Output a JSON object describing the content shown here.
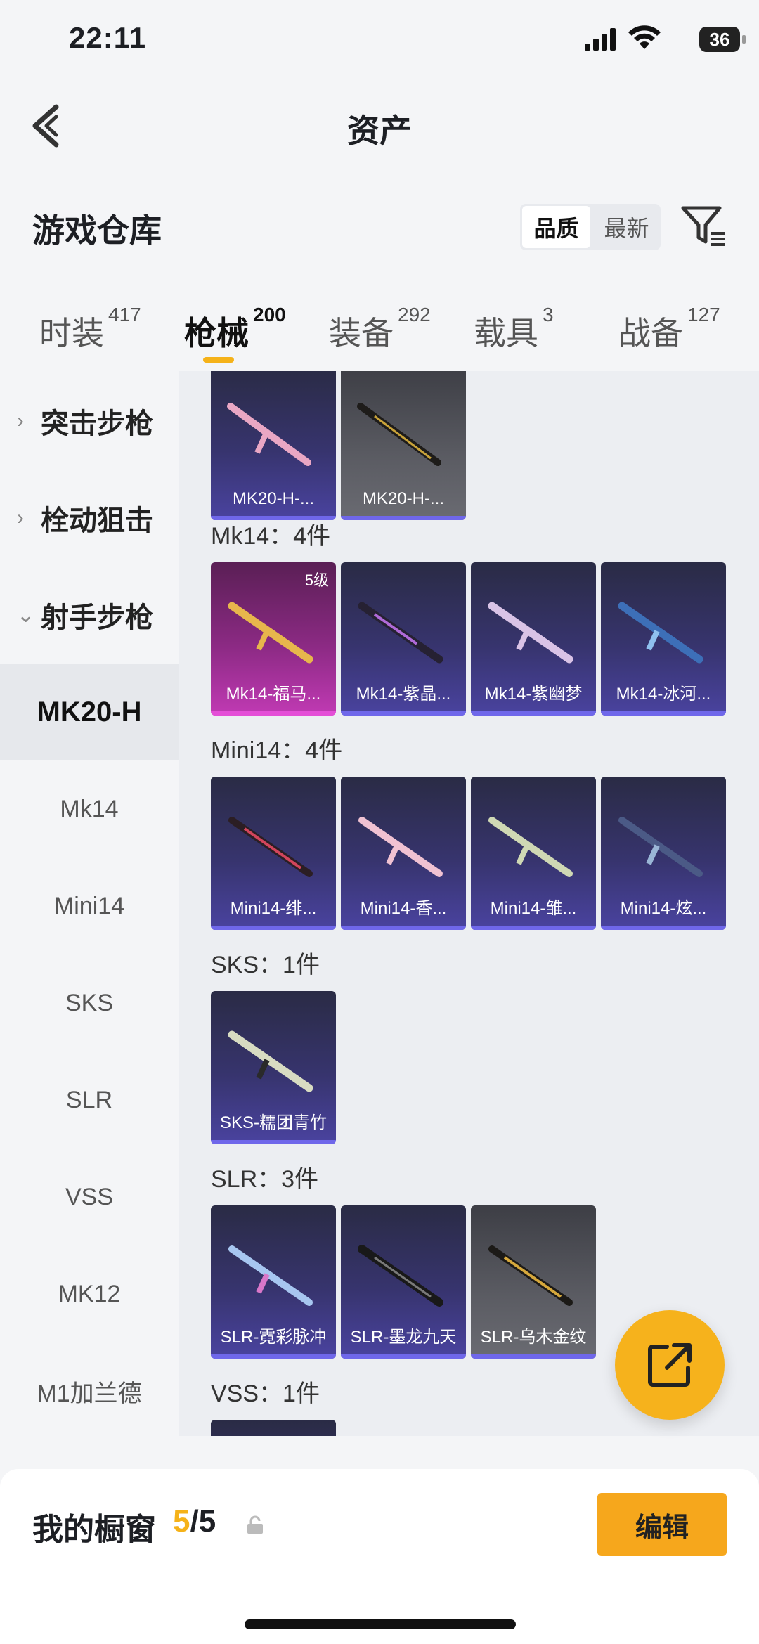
{
  "status": {
    "time": "22:11",
    "battery": "36"
  },
  "nav": {
    "title": "资产"
  },
  "header": {
    "title": "游戏仓库",
    "sort_quality": "品质",
    "sort_latest": "最新"
  },
  "tabs": [
    {
      "label": "时装",
      "count": "417"
    },
    {
      "label": "枪械",
      "count": "200"
    },
    {
      "label": "装备",
      "count": "292"
    },
    {
      "label": "载具",
      "count": "3"
    },
    {
      "label": "战备",
      "count": "127"
    }
  ],
  "sidebar": {
    "categories": [
      "突击步枪",
      "栓动狙击",
      "射手步枪"
    ],
    "subitems": [
      "MK20-H",
      "Mk14",
      "Mini14",
      "SKS",
      "SLR",
      "VSS",
      "MK12",
      "M1加兰德"
    ]
  },
  "content": {
    "top_cards": [
      "MK20-H-...",
      "MK20-H-..."
    ],
    "groups": [
      {
        "label": "Mk14：4件",
        "items": [
          "Mk14-福马...",
          "Mk14-紫晶...",
          "Mk14-紫幽梦",
          "Mk14-冰河..."
        ],
        "level": "5级"
      },
      {
        "label": "Mini14：4件",
        "items": [
          "Mini14-绯...",
          "Mini14-香...",
          "Mini14-雏...",
          "Mini14-炫..."
        ]
      },
      {
        "label": "SKS：1件",
        "items": [
          "SKS-糯团青竹"
        ]
      },
      {
        "label": "SLR：3件",
        "items": [
          "SLR-霓彩脉冲",
          "SLR-墨龙九天",
          "SLR-乌木金纹"
        ]
      },
      {
        "label": "VSS：1件",
        "items": []
      }
    ]
  },
  "bottom": {
    "label": "我的橱窗",
    "current": "5",
    "total": "/5",
    "edit": "编辑"
  },
  "colors": {
    "accent": "#f5b219",
    "purple_card": "#4a43a0",
    "pink_card": "#c13ab4",
    "gray_card": "#5b5c63"
  }
}
